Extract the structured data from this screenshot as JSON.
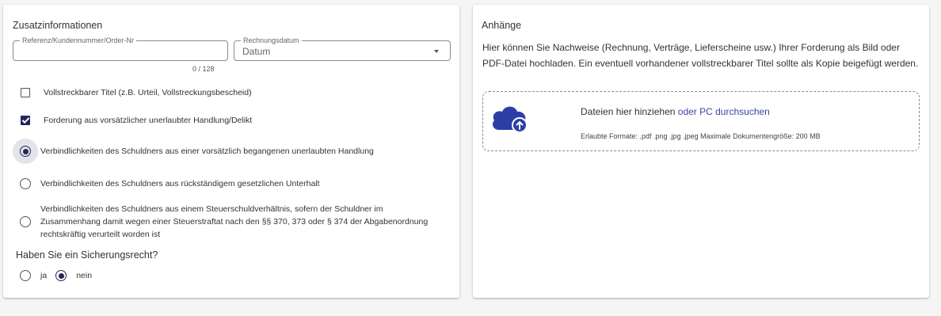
{
  "additional_info": {
    "title": "Zusatzinformationen",
    "reference_field": {
      "label": "Referenz/Kundennummer/Order-Nr",
      "value": "",
      "counter": "0 / 128"
    },
    "invoice_date_field": {
      "label": "Rechnungsdatum",
      "value": "Datum"
    },
    "checkboxes": [
      {
        "label": "Vollstreckbarer Titel (z.B. Urteil, Vollstreckungsbescheid)",
        "checked": false
      },
      {
        "label": "Forderung aus vorsätzlicher unerlaubter Handlung/Delikt",
        "checked": true
      }
    ],
    "liability_options": [
      {
        "label": "Verbindlichkeiten des Schuldners aus einer vorsätzlich begangenen unerlaubten Handlung",
        "selected": true
      },
      {
        "label": "Verbindlichkeiten des Schuldners aus rückständigem gesetzlichen Unterhalt",
        "selected": false
      },
      {
        "label": "Verbindlichkeiten des Schuldners aus einem Steuerschuldverhältnis, sofern der Schuldner im Zusammenhang damit wegen einer Steuerstraftat nach den §§ 370, 373 oder § 374 der Abgabenordnung rechtskräftig verurteilt worden ist",
        "selected": false
      }
    ],
    "security_question": "Haben Sie ein Sicherungsrecht?",
    "security_options": [
      {
        "label": "ja",
        "selected": false
      },
      {
        "label": "nein",
        "selected": true
      }
    ]
  },
  "attachments": {
    "title": "Anhänge",
    "description": "Hier können Sie Nachweise (Rechnung, Verträge, Lieferscheine usw.) Ihrer Forderung als Bild oder PDF-Datei hochladen. Ein eventuell vorhandener vollstreckbarer Titel sollte als Kopie beigefügt werden.",
    "dropzone_text": "Dateien hier hinziehen",
    "dropzone_link": "oder PC durchsuchen",
    "dropzone_hint": "Erlaubte Formate: .pdf .png .jpg .jpeg Maximale Dokumentengröße: 200 MB",
    "icon": "cloud-upload-icon"
  },
  "colors": {
    "primary": "#23265a",
    "link": "#3a45a8",
    "cloud": "#2c3ea6",
    "background": "#f5f5f5"
  }
}
